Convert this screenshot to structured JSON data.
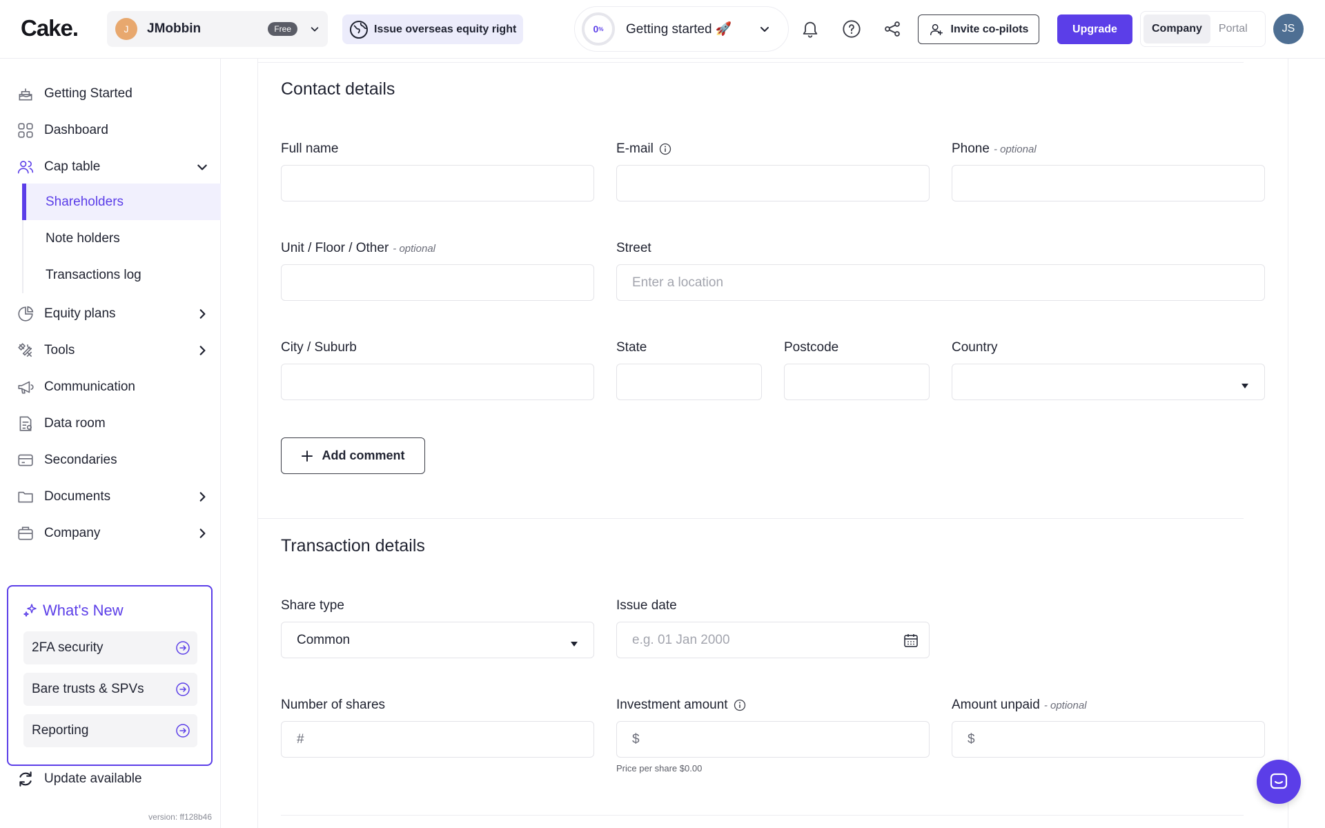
{
  "app": {
    "logo": "Cake."
  },
  "org": {
    "avatar_letter": "J",
    "name": "JMobbin",
    "plan_badge": "Free"
  },
  "header": {
    "overseas_label": "Issue overseas equity right",
    "getting_started": {
      "percent": "0",
      "percent_unit": "%",
      "label": "Getting started 🚀"
    },
    "invite_label": "Invite co-pilots",
    "upgrade_label": "Upgrade",
    "segments": [
      "Company",
      "Portal"
    ],
    "active_segment": "Company",
    "user_initials": "JS"
  },
  "sidebar": {
    "items": [
      {
        "label": "Getting Started",
        "icon": "cake-icon"
      },
      {
        "label": "Dashboard",
        "icon": "grid-icon"
      },
      {
        "label": "Cap table",
        "icon": "users-icon",
        "expanded": true
      },
      {
        "label": "Equity plans",
        "icon": "pie-icon"
      },
      {
        "label": "Tools",
        "icon": "tools-icon"
      },
      {
        "label": "Communication",
        "icon": "megaphone-icon"
      },
      {
        "label": "Data room",
        "icon": "data-room-icon"
      },
      {
        "label": "Secondaries",
        "icon": "secondaries-icon"
      },
      {
        "label": "Documents",
        "icon": "folder-icon"
      },
      {
        "label": "Company",
        "icon": "briefcase-icon"
      }
    ],
    "cap_table_sub": [
      "Shareholders",
      "Note holders",
      "Transactions log"
    ],
    "active_sub": "Shareholders",
    "whats_new": {
      "title": "What's New",
      "items": [
        "2FA security",
        "Bare trusts & SPVs",
        "Reporting"
      ]
    },
    "update_label": "Update available",
    "version": "version: ff128b46"
  },
  "contact": {
    "title": "Contact details",
    "full_name_label": "Full name",
    "email_label": "E-mail",
    "phone_label": "Phone",
    "optional": "- optional",
    "unit_label": "Unit / Floor / Other",
    "street_label": "Street",
    "street_placeholder": "Enter a location",
    "city_label": "City / Suburb",
    "state_label": "State",
    "postcode_label": "Postcode",
    "country_label": "Country",
    "add_comment": "Add comment"
  },
  "transaction": {
    "title": "Transaction details",
    "share_type_label": "Share type",
    "share_type_value": "Common",
    "issue_date_label": "Issue date",
    "issue_date_placeholder": "e.g. 01 Jan 2000",
    "shares_label": "Number of shares",
    "shares_prefix": "#",
    "investment_label": "Investment amount",
    "investment_prefix": "$",
    "price_hint": "Price per share $0.00",
    "unpaid_label": "Amount unpaid",
    "unpaid_prefix": "$"
  },
  "colors": {
    "accent": "#5b3ee8",
    "text": "#1f2230",
    "border": "#e3e3e8"
  }
}
